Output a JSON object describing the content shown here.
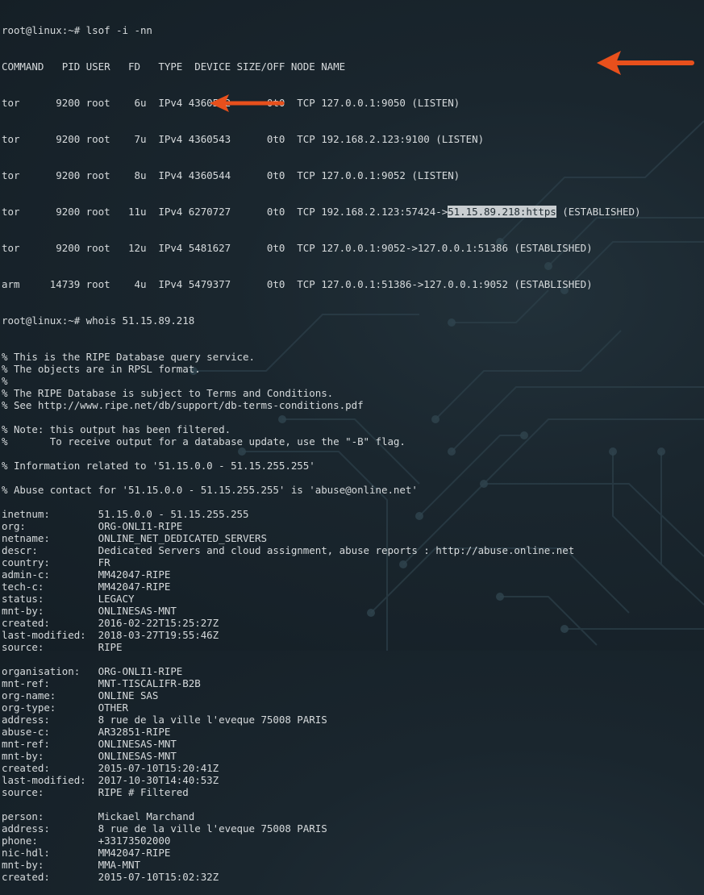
{
  "terminal": {
    "prompt": "root@linux:~# ",
    "command_lsof": "lsof -i -nn",
    "lsof_header": "COMMAND   PID USER   FD   TYPE  DEVICE SIZE/OFF NODE NAME",
    "lsof_rows": [
      "tor      9200 root    6u  IPv4 4360542      0t0  TCP 127.0.0.1:9050 (LISTEN)",
      "tor      9200 root    7u  IPv4 4360543      0t0  TCP 192.168.2.123:9100 (LISTEN)",
      "tor      9200 root    8u  IPv4 4360544      0t0  TCP 127.0.0.1:9052 (LISTEN)"
    ],
    "lsof_hl_row": {
      "pre": "tor      9200 root   11u  IPv4 6270727      0t0  TCP 192.168.2.123:57424->",
      "highlight": "51.15.89.218:https",
      "post": " (ESTABLISHED)"
    },
    "lsof_rows_after": [
      "tor      9200 root   12u  IPv4 5481627      0t0  TCP 127.0.0.1:9052->127.0.0.1:51386 (ESTABLISHED)",
      "arm     14739 root    4u  IPv4 5479377      0t0  TCP 127.0.0.1:51386->127.0.0.1:9052 (ESTABLISHED)"
    ],
    "command_whois": "whois 51.15.89.218",
    "whois_output": [
      "% This is the RIPE Database query service.",
      "% The objects are in RPSL format.",
      "%",
      "% The RIPE Database is subject to Terms and Conditions.",
      "% See http://www.ripe.net/db/support/db-terms-conditions.pdf",
      "",
      "% Note: this output has been filtered.",
      "%       To receive output for a database update, use the \"-B\" flag.",
      "",
      "% Information related to '51.15.0.0 - 51.15.255.255'",
      "",
      "% Abuse contact for '51.15.0.0 - 51.15.255.255' is 'abuse@online.net'",
      "",
      "inetnum:        51.15.0.0 - 51.15.255.255",
      "org:            ORG-ONLI1-RIPE",
      "netname:        ONLINE_NET_DEDICATED_SERVERS",
      "descr:          Dedicated Servers and cloud assignment, abuse reports : http://abuse.online.net",
      "country:        FR",
      "admin-c:        MM42047-RIPE",
      "tech-c:         MM42047-RIPE",
      "status:         LEGACY",
      "mnt-by:         ONLINESAS-MNT",
      "created:        2016-02-22T15:25:27Z",
      "last-modified:  2018-03-27T19:55:46Z",
      "source:         RIPE",
      "",
      "organisation:   ORG-ONLI1-RIPE",
      "mnt-ref:        MNT-TISCALIFR-B2B",
      "org-name:       ONLINE SAS",
      "org-type:       OTHER",
      "address:        8 rue de la ville l'eveque 75008 PARIS",
      "abuse-c:        AR32851-RIPE",
      "mnt-ref:        ONLINESAS-MNT",
      "mnt-by:         ONLINESAS-MNT",
      "created:        2015-07-10T15:20:41Z",
      "last-modified:  2017-10-30T14:40:53Z",
      "source:         RIPE # Filtered",
      "",
      "person:         Mickael Marchand",
      "address:        8 rue de la ville l'eveque 75008 PARIS",
      "phone:          +33173502000",
      "nic-hdl:        MM42047-RIPE",
      "mnt-by:         MMA-MNT",
      "created:        2015-07-10T15:02:32Z"
    ]
  },
  "annotations": {
    "arrow_color": "#e8501c"
  }
}
